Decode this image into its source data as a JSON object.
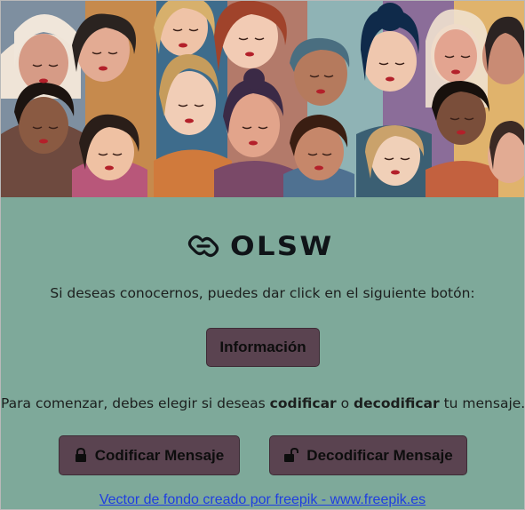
{
  "hero": {
    "image_alt": "illustrated crowd of diverse women"
  },
  "brand": {
    "name": "OLSW",
    "icon": "chain-link-icon"
  },
  "intro": {
    "text": "Si deseas conocernos, puedes dar click en el siguiente botón:"
  },
  "info_button": {
    "label": "Información"
  },
  "instructions": {
    "part1": "Para comenzar, debes elegir si deseas ",
    "encode_word": "codificar",
    "part2": " o ",
    "decode_word": "decodificar",
    "part3": " tu mensaje."
  },
  "encode_button": {
    "label": "Codificar Mensaje",
    "icon": "lock-icon"
  },
  "decode_button": {
    "label": "Decodificar Mensaje",
    "icon": "unlock-icon"
  },
  "credit": {
    "text": "Vector de fondo creado por freepik - www.freepik.es"
  },
  "colors": {
    "panel": "#7ea99a",
    "button": "#5a4350",
    "link": "#1f3ee0"
  }
}
